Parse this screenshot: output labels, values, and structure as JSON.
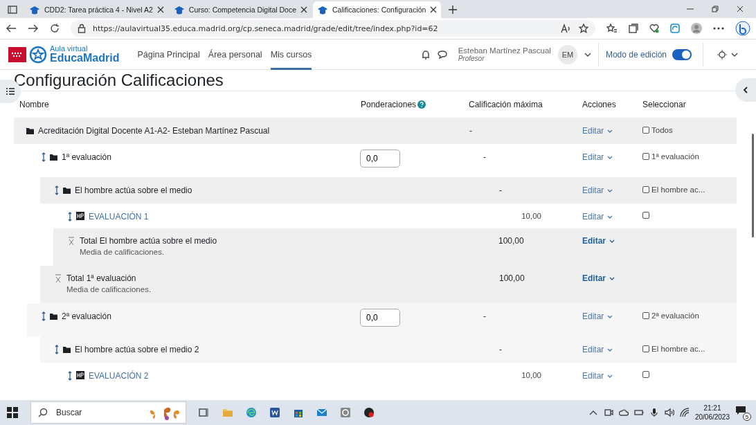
{
  "browser": {
    "tabs": [
      {
        "title": "CDD2: Tarea práctica 4 - Nivel A2",
        "selected": false
      },
      {
        "title": "Curso: Competencia Digital Doce",
        "selected": false
      },
      {
        "title": "Calificaciones: Configuración",
        "selected": true
      }
    ],
    "url": "https://aulavirtual35.educa.madrid.org/cp.seneca.madrid/grade/edit/tree/index.php?id=62"
  },
  "site_header": {
    "logo_top": "Aula virtual",
    "logo_bottom": "EducaMadrid",
    "nav": [
      {
        "label": "Página Principal",
        "selected": false
      },
      {
        "label": "Área personal",
        "selected": false
      },
      {
        "label": "Mis cursos",
        "selected": true
      }
    ],
    "user_name": "Esteban Martínez Pascual",
    "user_role": "Profesor",
    "avatar_initials": "EM",
    "edit_mode": {
      "label": "Modo de edición",
      "on": true
    }
  },
  "page_title": "Configuración Calificaciones",
  "table": {
    "columns": [
      {
        "label": "Nombre",
        "help": false
      },
      {
        "label": "Ponderaciones",
        "help": true
      },
      {
        "label": "Calificación máxima",
        "help": false
      },
      {
        "label": "Acciones",
        "help": false
      },
      {
        "label": "Seleccionar",
        "help": false
      }
    ],
    "rows": [
      {
        "kind": "category",
        "name": "Acreditación Digital Docente A1-A2- Esteban Martínez Pascual",
        "max": "-",
        "action": "Editar",
        "select": {
          "label": "Todos",
          "checked": false
        },
        "children": [
          {
            "kind": "category",
            "name": "1ª evaluación",
            "weight": "0,0",
            "max": "-",
            "action": "Editar",
            "select": {
              "label": "1ª evaluación",
              "checked": false
            },
            "children": [
              {
                "kind": "category",
                "name": "El hombre actúa sobre el medio",
                "max": "-",
                "action": "Editar",
                "select": {
                  "label": "El hombre ac...",
                  "checked": false
                },
                "children": [
                  {
                    "kind": "item",
                    "name": "EVALUACIÓN 1",
                    "max": "10,00",
                    "action": "Editar",
                    "select": {
                      "checked": false
                    }
                  }
                ],
                "total": {
                  "name": "Total El hombre actúa sobre el medio",
                  "subtitle": "Media de calificaciones.",
                  "max": "100,00",
                  "action": "Editar"
                }
              }
            ],
            "total": {
              "name": "Total 1ª evaluación",
              "subtitle": "Media de calificaciones.",
              "max": "100,00",
              "action": "Editar"
            }
          },
          {
            "kind": "category",
            "name": "2ª evaluación",
            "weight": "0,0",
            "max": "-",
            "action": "Editar",
            "select": {
              "label": "2ª evaluación",
              "checked": false
            },
            "children": [
              {
                "kind": "category",
                "name": "El hombre actúa sobre el medio 2",
                "max": "-",
                "action": "Editar",
                "select": {
                  "label": "El hombre ac...",
                  "checked": false
                },
                "children": [
                  {
                    "kind": "item",
                    "name": "EVALUACIÓN 2",
                    "max": "10,00",
                    "action": "Editar",
                    "select": {
                      "checked": false
                    }
                  }
                ]
              }
            ]
          }
        ]
      }
    ]
  },
  "taskbar": {
    "search_placeholder": "Buscar",
    "time": "21:21",
    "date": "20/06/2023",
    "notifications": "5"
  }
}
